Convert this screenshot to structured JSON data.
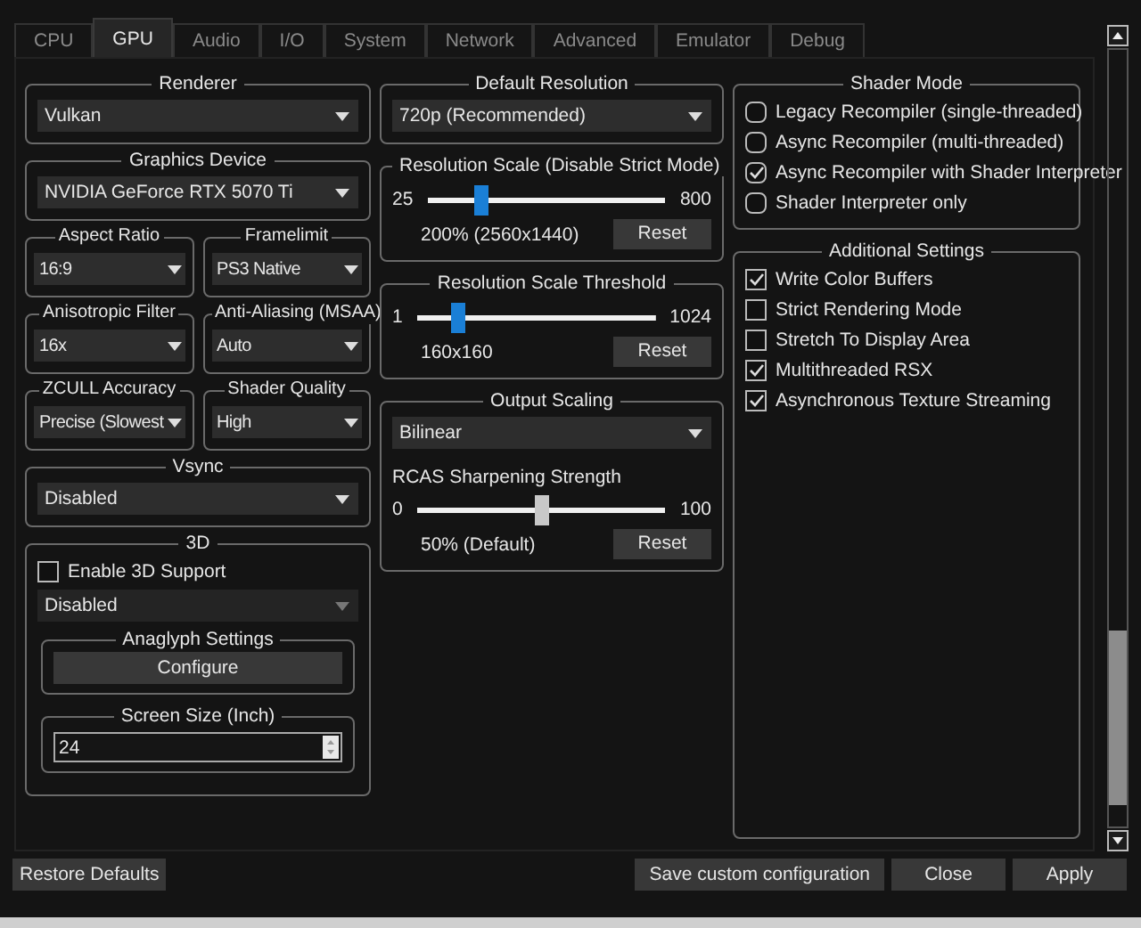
{
  "tabs": [
    {
      "label": "CPU",
      "selected": false
    },
    {
      "label": "GPU",
      "selected": true
    },
    {
      "label": "Audio",
      "selected": false
    },
    {
      "label": "I/O",
      "selected": false
    },
    {
      "label": "System",
      "selected": false
    },
    {
      "label": "Network",
      "selected": false
    },
    {
      "label": "Advanced",
      "selected": false
    },
    {
      "label": "Emulator",
      "selected": false
    },
    {
      "label": "Debug",
      "selected": false
    }
  ],
  "columns": [
    [
      {
        "kind": "select",
        "title": "Renderer",
        "value": "Vulkan"
      },
      {
        "kind": "select",
        "title": "Graphics Device",
        "value": "NVIDIA GeForce RTX 5070 Ti"
      },
      {
        "kind": "row",
        "groups": [
          {
            "kind": "select",
            "title": "Aspect Ratio",
            "value": "16:9"
          },
          {
            "kind": "select",
            "title": "Framelimit",
            "value": "PS3 Native"
          }
        ]
      },
      {
        "kind": "row",
        "groups": [
          {
            "kind": "select",
            "title": "Anisotropic Filter",
            "value": "16x"
          },
          {
            "kind": "select",
            "title": "Anti-Aliasing (MSAA)",
            "value": "Auto"
          }
        ]
      },
      {
        "kind": "row",
        "groups": [
          {
            "kind": "select",
            "title": "ZCULL Accuracy",
            "value": "Precise (Slowest"
          },
          {
            "kind": "select",
            "title": "Shader Quality",
            "value": "High"
          }
        ]
      },
      {
        "kind": "select",
        "title": "Vsync",
        "value": "Disabled"
      },
      {
        "kind": "stereo",
        "title": "3D",
        "checkbox": {
          "label": "Enable 3D Support",
          "checked": false
        },
        "value": "Disabled",
        "disabled": true,
        "anaglyph": {
          "title": "Anaglyph Settings",
          "button": "Configure"
        },
        "screen": {
          "title": "Screen Size (Inch)",
          "value": "24"
        }
      }
    ],
    [
      {
        "kind": "select",
        "title": "Default Resolution",
        "value": "720p (Recommended)"
      },
      {
        "kind": "slider",
        "title": "Resolution Scale (Disable Strict Mode)",
        "min": "25",
        "max": "800",
        "level": 0.23,
        "reading": "200% (2560x1440)",
        "button": "Reset"
      },
      {
        "kind": "slider",
        "title": "Resolution Scale Threshold",
        "min": "1",
        "max": "1024",
        "level": 0.17,
        "reading": "160x160",
        "button": "Reset"
      },
      {
        "kind": "scaling",
        "title": "Output Scaling",
        "value": "Bilinear",
        "label": "RCAS Sharpening Strength",
        "min": "0",
        "max": "100",
        "level": 0.5,
        "reading": "50% (Default)",
        "button": "Reset"
      }
    ],
    [
      {
        "kind": "radio_list",
        "title": "Shader Mode",
        "items": [
          {
            "label": "Legacy Recompiler (single-threaded)",
            "checked": false
          },
          {
            "label": "Async Recompiler (multi-threaded)",
            "checked": false
          },
          {
            "label": "Async Recompiler with Shader Interpreter",
            "checked": true
          },
          {
            "label": "Shader Interpreter only",
            "checked": false
          }
        ]
      },
      {
        "kind": "check_list",
        "title": "Additional Settings",
        "items": [
          {
            "label": "Write Color Buffers",
            "checked": true
          },
          {
            "label": "Strict Rendering Mode",
            "checked": false
          },
          {
            "label": "Stretch To Display Area",
            "checked": false
          },
          {
            "label": "Multithreaded RSX",
            "checked": true
          },
          {
            "label": "Asynchronous Texture Streaming",
            "checked": true
          }
        ]
      }
    ]
  ],
  "footer": {
    "left": [
      "Restore Defaults"
    ],
    "right": [
      "Save custom configuration",
      "Close",
      "Apply"
    ]
  }
}
